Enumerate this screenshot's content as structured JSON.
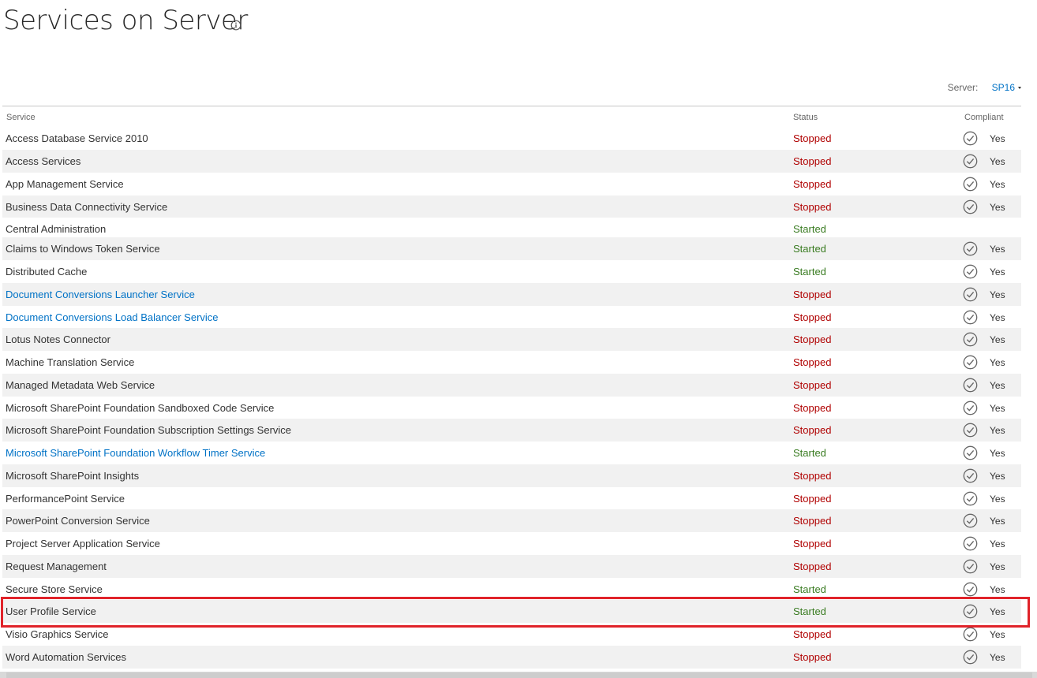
{
  "page": {
    "title": "Services on Server"
  },
  "server": {
    "label": "Server:",
    "value": "SP16"
  },
  "table": {
    "columns": {
      "service": "Service",
      "status": "Status",
      "compliant": "Compliant"
    },
    "rows": [
      {
        "service": "Access Database Service 2010",
        "link": false,
        "status": "Stopped",
        "compliant": "Yes"
      },
      {
        "service": "Access Services",
        "link": false,
        "status": "Stopped",
        "compliant": "Yes"
      },
      {
        "service": "App Management Service",
        "link": false,
        "status": "Stopped",
        "compliant": "Yes"
      },
      {
        "service": "Business Data Connectivity Service",
        "link": false,
        "status": "Stopped",
        "compliant": "Yes"
      },
      {
        "service": "Central Administration",
        "link": false,
        "status": "Started",
        "compliant": ""
      },
      {
        "service": "Claims to Windows Token Service",
        "link": false,
        "status": "Started",
        "compliant": "Yes"
      },
      {
        "service": "Distributed Cache",
        "link": false,
        "status": "Started",
        "compliant": "Yes"
      },
      {
        "service": "Document Conversions Launcher Service",
        "link": true,
        "status": "Stopped",
        "compliant": "Yes"
      },
      {
        "service": "Document Conversions Load Balancer Service",
        "link": true,
        "status": "Stopped",
        "compliant": "Yes"
      },
      {
        "service": "Lotus Notes Connector",
        "link": false,
        "status": "Stopped",
        "compliant": "Yes"
      },
      {
        "service": "Machine Translation Service",
        "link": false,
        "status": "Stopped",
        "compliant": "Yes"
      },
      {
        "service": "Managed Metadata Web Service",
        "link": false,
        "status": "Stopped",
        "compliant": "Yes"
      },
      {
        "service": "Microsoft SharePoint Foundation Sandboxed Code Service",
        "link": false,
        "status": "Stopped",
        "compliant": "Yes"
      },
      {
        "service": "Microsoft SharePoint Foundation Subscription Settings Service",
        "link": false,
        "status": "Stopped",
        "compliant": "Yes"
      },
      {
        "service": "Microsoft SharePoint Foundation Workflow Timer Service",
        "link": true,
        "status": "Started",
        "compliant": "Yes"
      },
      {
        "service": "Microsoft SharePoint Insights",
        "link": false,
        "status": "Stopped",
        "compliant": "Yes"
      },
      {
        "service": "PerformancePoint Service",
        "link": false,
        "status": "Stopped",
        "compliant": "Yes"
      },
      {
        "service": "PowerPoint Conversion Service",
        "link": false,
        "status": "Stopped",
        "compliant": "Yes"
      },
      {
        "service": "Project Server Application Service",
        "link": false,
        "status": "Stopped",
        "compliant": "Yes"
      },
      {
        "service": "Request Management",
        "link": false,
        "status": "Stopped",
        "compliant": "Yes"
      },
      {
        "service": "Secure Store Service",
        "link": false,
        "status": "Started",
        "compliant": "Yes"
      },
      {
        "service": "User Profile Service",
        "link": false,
        "status": "Started",
        "compliant": "Yes",
        "highlighted": true
      },
      {
        "service": "Visio Graphics Service",
        "link": false,
        "status": "Stopped",
        "compliant": "Yes"
      },
      {
        "service": "Word Automation Services",
        "link": false,
        "status": "Stopped",
        "compliant": "Yes"
      }
    ]
  },
  "colors": {
    "stopped": "#b00000",
    "started": "#3a7c22",
    "link": "#0072c6",
    "highlight": "#e0232a",
    "alt_row": "#f1f1f1"
  },
  "icons": {
    "title_info": "info-icon",
    "compliant": "check-circle-icon",
    "server_dropdown": "caret-down-icon"
  }
}
